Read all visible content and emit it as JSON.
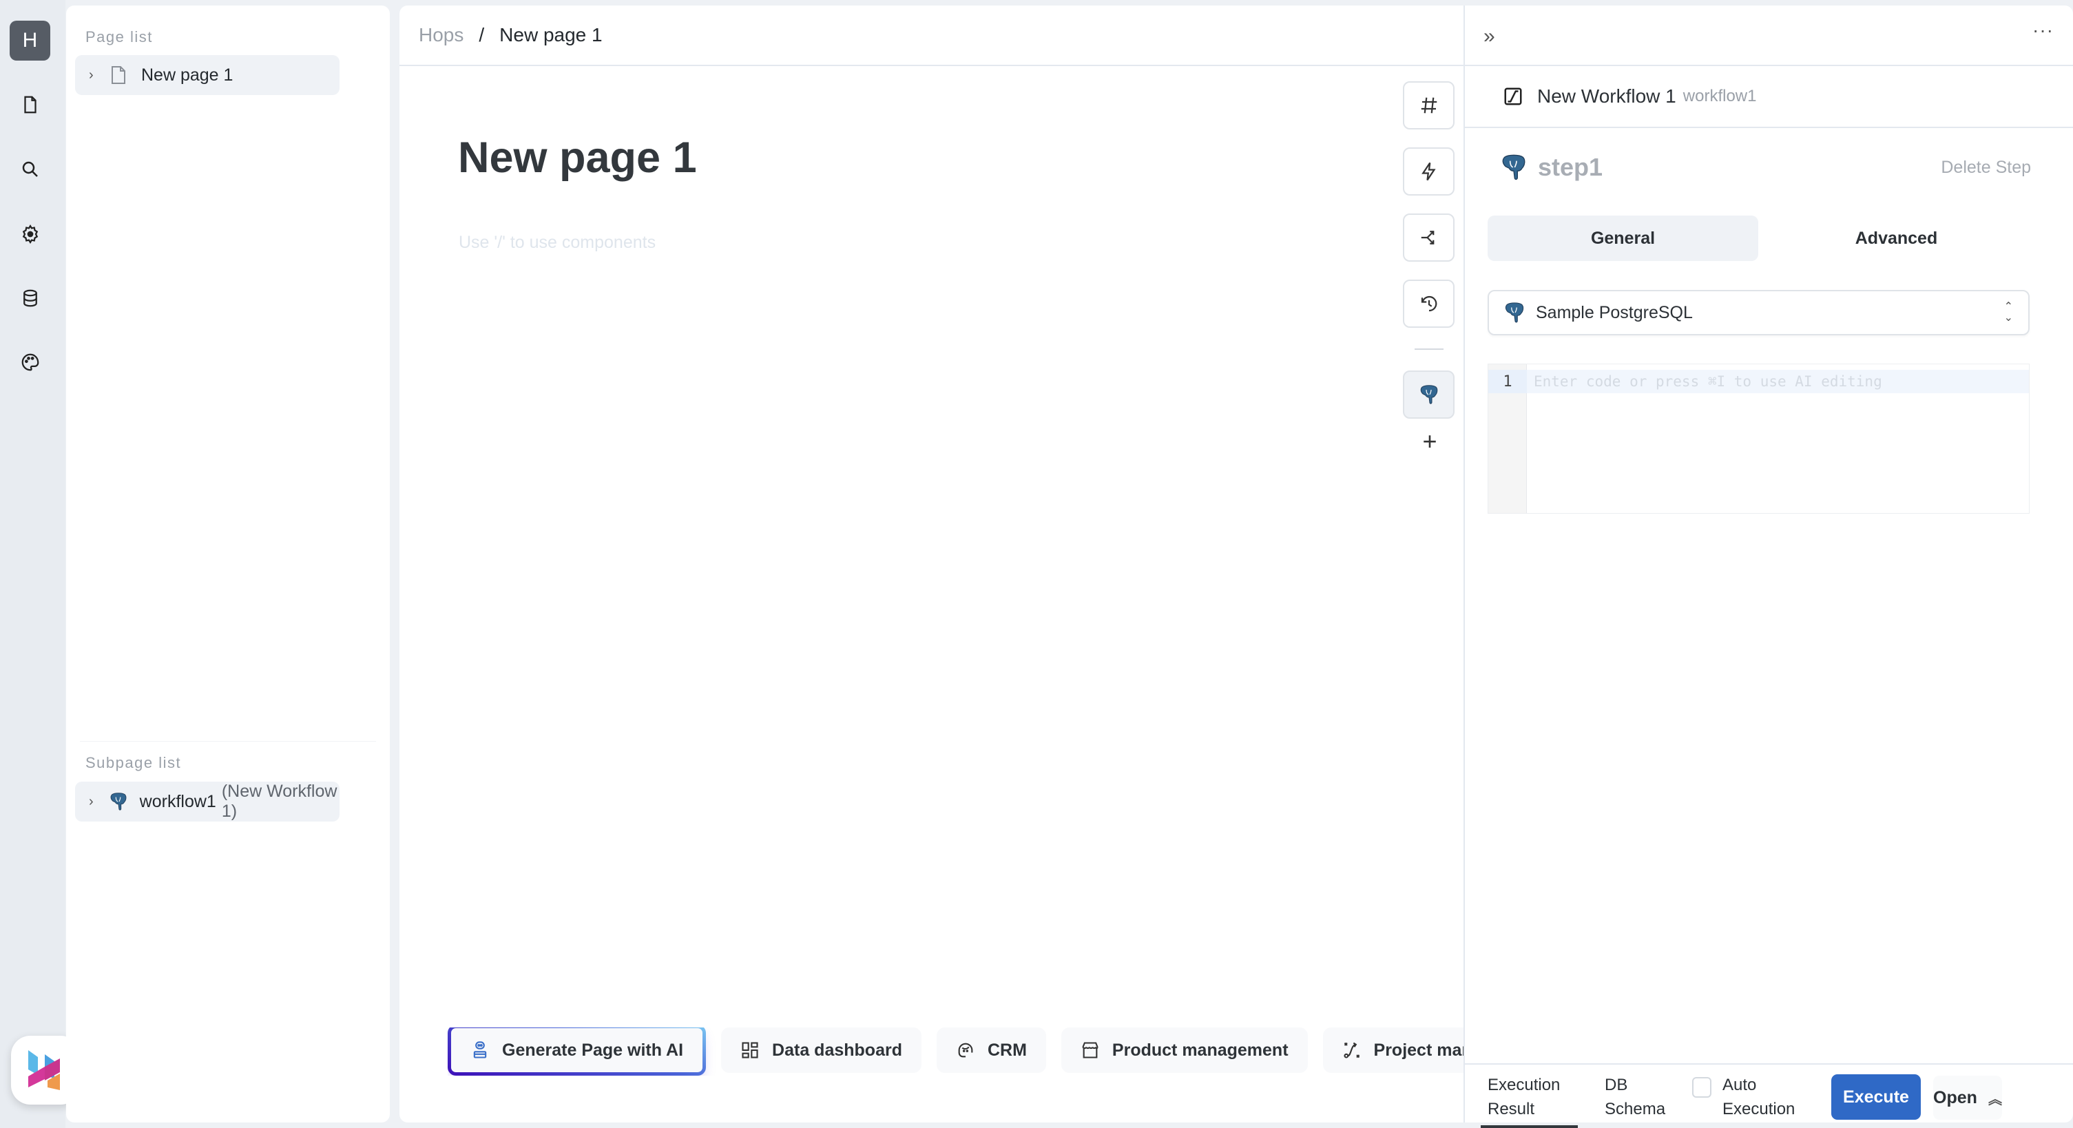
{
  "rail": {
    "avatar_letter": "H",
    "items": [
      {
        "icon": "file-icon"
      },
      {
        "icon": "search-icon"
      },
      {
        "icon": "gear-icon"
      },
      {
        "icon": "database-icon"
      },
      {
        "icon": "palette-icon"
      }
    ],
    "logo": "hops-logo"
  },
  "page_list": {
    "label": "Page list",
    "items": [
      {
        "label": "New page 1",
        "icon": "file-icon"
      }
    ]
  },
  "subpage_list": {
    "label": "Subpage list",
    "items": [
      {
        "label": "workflow1",
        "sub": "(New Workflow 1)",
        "icon": "postgresql-icon"
      }
    ]
  },
  "breadcrumb": {
    "root": "Hops",
    "separator": "/",
    "current": "New page 1"
  },
  "editor": {
    "title": "New page 1",
    "placeholder": "Use '/' to use components"
  },
  "toolbar": {
    "buttons": [
      {
        "icon": "hash-icon"
      },
      {
        "icon": "lightning-icon"
      },
      {
        "icon": "branch-icon"
      },
      {
        "icon": "history-icon"
      },
      {
        "icon": "postgresql-icon",
        "active": true
      }
    ],
    "add_icon": "plus-icon"
  },
  "templates": [
    {
      "label": "Generate Page with AI",
      "icon": "robot-icon"
    },
    {
      "label": "Data dashboard",
      "icon": "dashboard-icon"
    },
    {
      "label": "CRM",
      "icon": "headset-icon"
    },
    {
      "label": "Product management",
      "icon": "store-icon"
    },
    {
      "label": "Project management",
      "icon": "route-icon"
    }
  ],
  "workflow": {
    "title": "New Workflow 1",
    "id": "workflow1",
    "step": {
      "name": "step1",
      "delete_label": "Delete Step"
    },
    "tabs": [
      {
        "label": "General",
        "active": true
      },
      {
        "label": "Advanced",
        "active": false
      }
    ],
    "datasource": {
      "selected": "Sample PostgreSQL"
    },
    "code_editor": {
      "line_number": "1",
      "placeholder": "Enter code or press ⌘I to use AI editing"
    },
    "bottom": {
      "tabs": [
        {
          "label_line1": "Execution",
          "label_line2": "Result",
          "active": true
        },
        {
          "label_line1": "DB",
          "label_line2": "Schema",
          "active": false
        }
      ],
      "auto_execution": {
        "line1": "Auto",
        "line2": "Execution",
        "checked": false
      },
      "execute_label": "Execute",
      "open_label": "Open"
    }
  },
  "colors": {
    "primary": "#2f69c6",
    "rail_bg": "#e8ecf1",
    "postgres_blue": "#336791"
  }
}
